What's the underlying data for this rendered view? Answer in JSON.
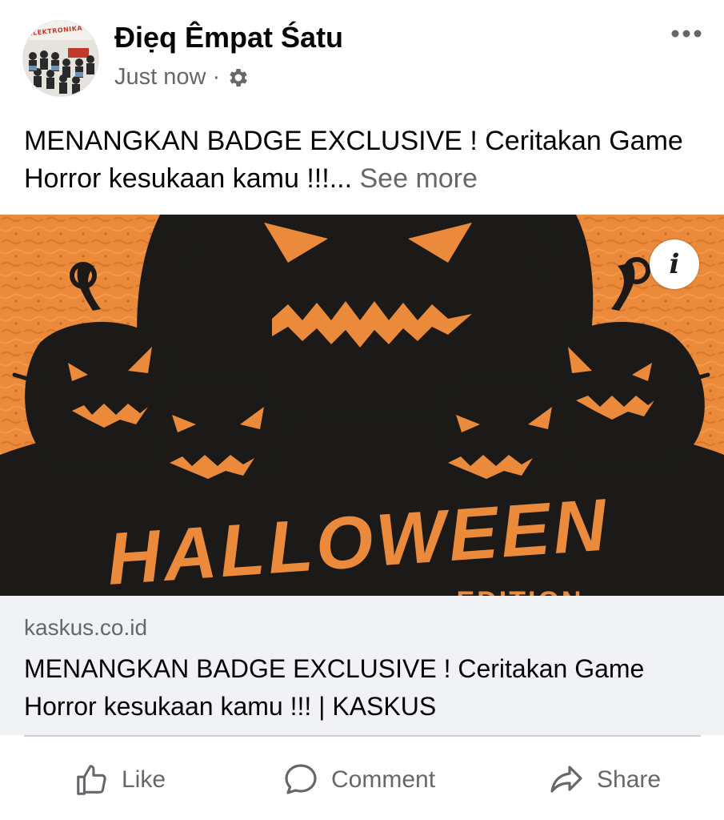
{
  "post": {
    "author": "Điẹq Êmpat Śatu",
    "timestamp": "Just now",
    "separator": "·",
    "privacy_icon": "gear-icon",
    "more_icon": "more-dots-icon",
    "avatar_text": "ELEKTRONIKA",
    "caption": {
      "text": "MENANGKAN BADGE EXCLUSIVE ! Ceritakan Game Horror kesukaan kamu !!!...",
      "see_more": "See more"
    }
  },
  "link_preview": {
    "image": {
      "headline": "HALLOWEEN",
      "subline": "EDITION",
      "info_icon": "info-icon",
      "info_glyph": "i",
      "colors": {
        "background": "#ea8a3a",
        "silhouette": "#1b1a19"
      }
    },
    "domain": "kaskus.co.id",
    "title": "MENANGKAN BADGE EXCLUSIVE ! Ceritakan Game Horror kesukaan kamu !!! | KASKUS"
  },
  "actions": {
    "like": {
      "label": "Like",
      "icon": "thumbs-up-icon"
    },
    "comment": {
      "label": "Comment",
      "icon": "comment-icon"
    },
    "share": {
      "label": "Share",
      "icon": "share-icon"
    }
  },
  "colors": {
    "text_primary": "#050505",
    "text_secondary": "#65676b",
    "link_background": "#f0f2f5",
    "divider": "#ced0d4",
    "accent_orange": "#ea8a3a"
  }
}
